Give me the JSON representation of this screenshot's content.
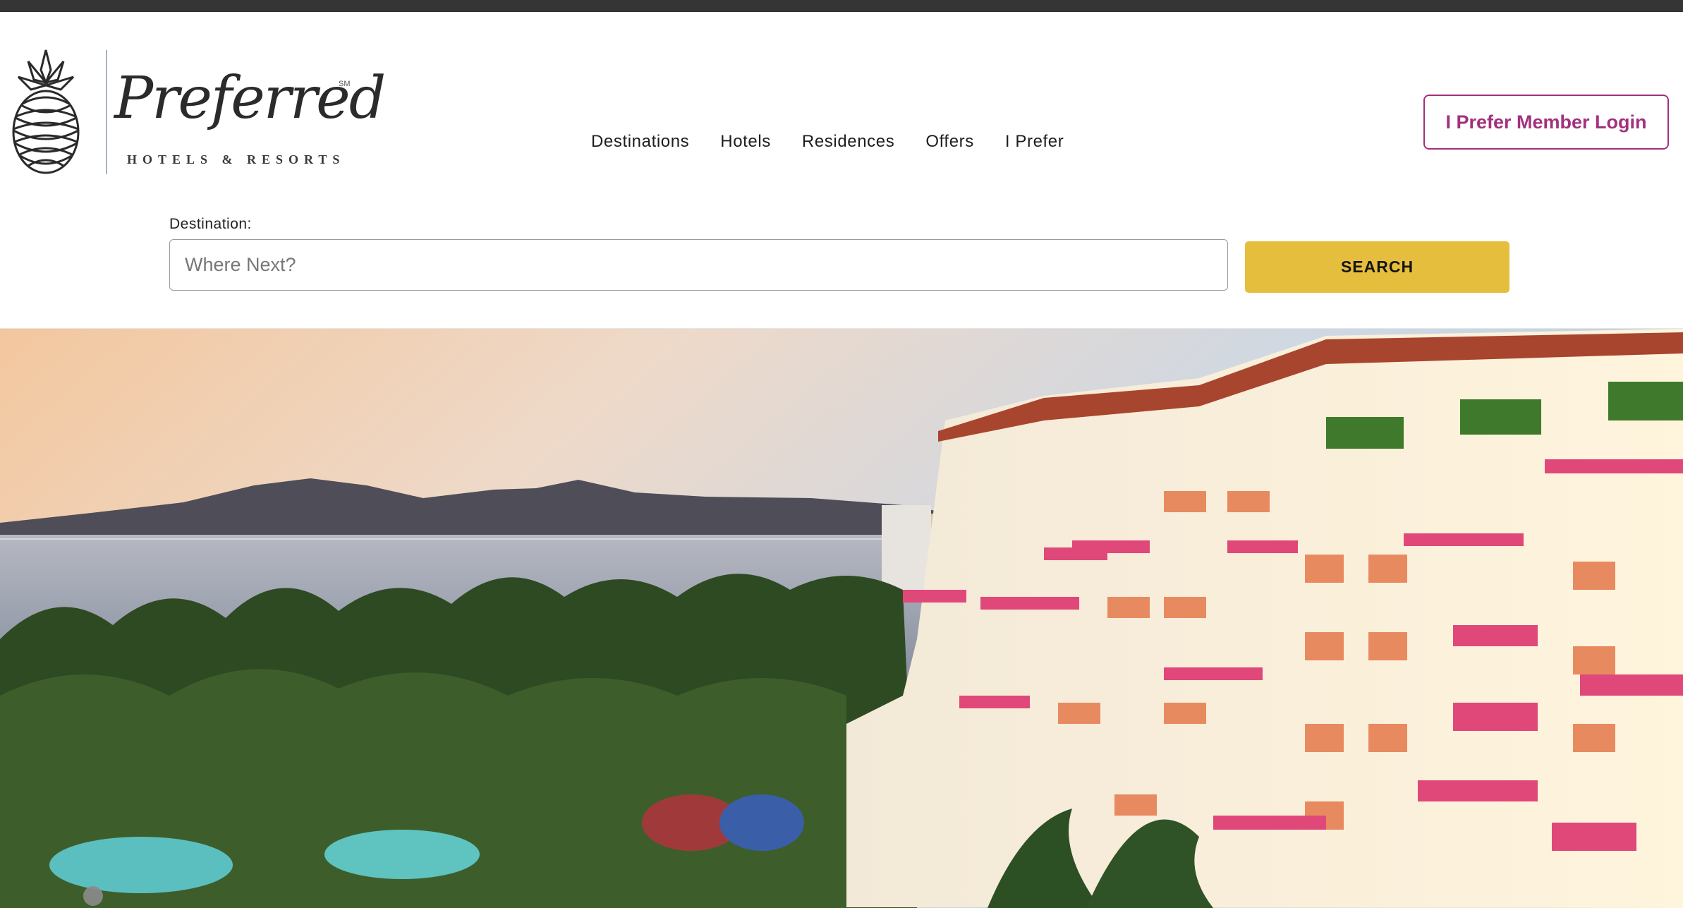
{
  "brand": {
    "name": "Preferred",
    "trademark": "SM",
    "subtitle": "HOTELS & RESORTS"
  },
  "nav": {
    "items": [
      {
        "label": "Destinations"
      },
      {
        "label": "Hotels"
      },
      {
        "label": "Residences"
      },
      {
        "label": "Offers"
      },
      {
        "label": "I Prefer"
      }
    ]
  },
  "login": {
    "label": "I Prefer Member Login"
  },
  "search": {
    "label": "Destination:",
    "placeholder": "Where Next?",
    "value": "",
    "button_label": "SEARCH"
  },
  "hero": {
    "carousel": {
      "current": 1
    }
  },
  "colors": {
    "accent_magenta": "#a2317e",
    "search_yellow": "#e6be3d",
    "topbar": "#353535"
  }
}
